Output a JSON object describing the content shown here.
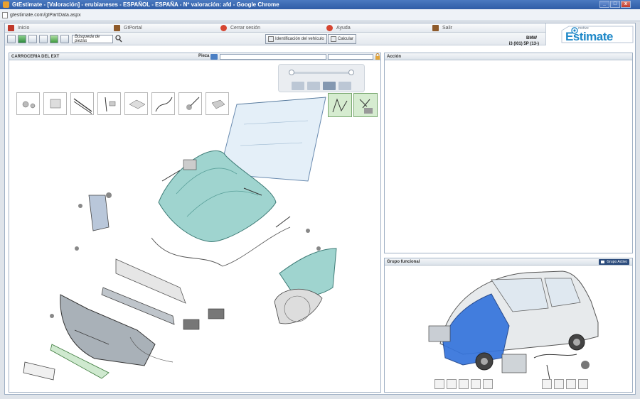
{
  "window": {
    "title": "GtEstimate - [Valoración] - erubianeses - ESPAÑOL - ESPAÑA - Nº valoración: afd - Google Chrome",
    "url": "gtestimate.com/gtPartData.aspx"
  },
  "menu": {
    "items": [
      {
        "label": "Inicio",
        "icon": "home-icon",
        "color": "#c0392b"
      },
      {
        "label": "GtPortal",
        "icon": "portal-icon",
        "color": "#8e5a2a"
      },
      {
        "label": "Cerrar sesión",
        "icon": "logout-icon",
        "color": "#d64531"
      },
      {
        "label": "Ayuda",
        "icon": "help-icon",
        "color": "#d64531"
      },
      {
        "label": "Salir",
        "icon": "exit-icon",
        "color": "#8e5a2a"
      }
    ]
  },
  "toolbar": {
    "search_label": "Búsqueda de piezas",
    "vehicle_id_label": "Identificación del vehículo",
    "calculate_label": "Calcular"
  },
  "brand": {
    "small": "motive",
    "name": "Estimate",
    "accent": "#1e88c8"
  },
  "vehicle": {
    "make": "BMW",
    "model": "i3 (I01) 5P (13-)"
  },
  "parts_panel": {
    "title": "CARROCERIA DEL EXT",
    "piece_label": "Pieza"
  },
  "actions_panel": {
    "title": "Acción"
  },
  "group_panel": {
    "title": "Grupo funcional",
    "button_label": "Grupo Activo",
    "highlight_color": "#2f6fd8"
  }
}
